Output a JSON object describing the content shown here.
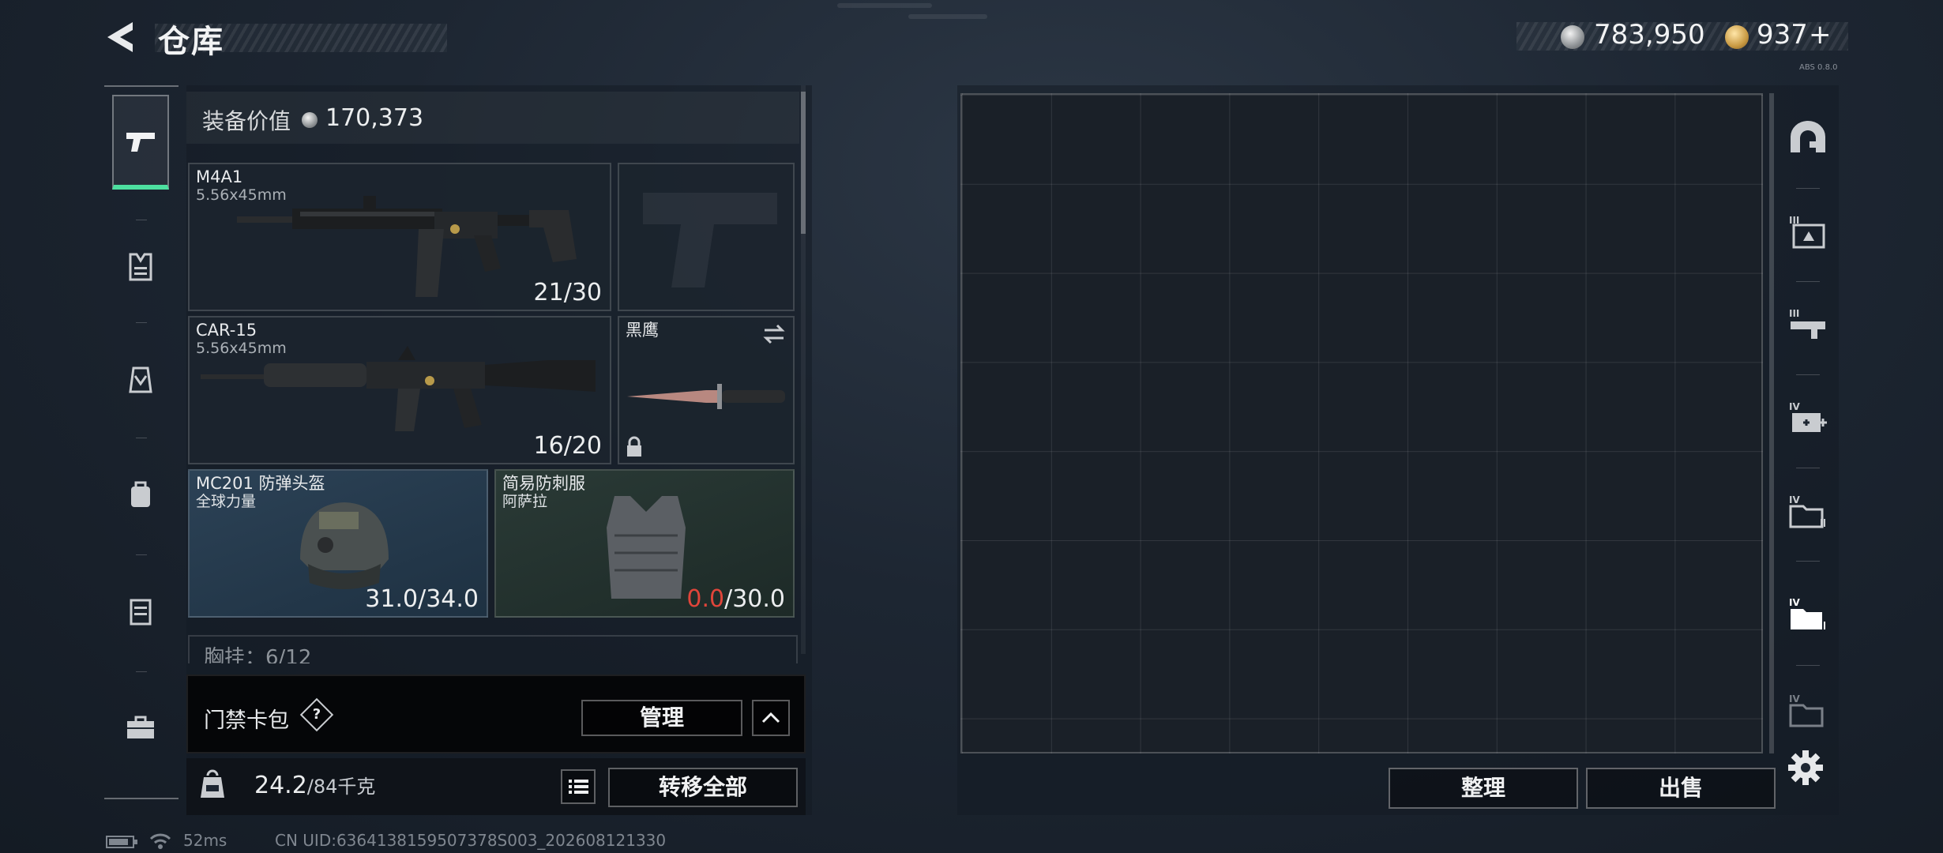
{
  "header": {
    "title": "仓库",
    "silver_currency": "783,950",
    "gold_currency": "937",
    "gold_plus": "+",
    "version": "ABS 0.8.0"
  },
  "equipment": {
    "value_label": "装备价值",
    "value": "170,373",
    "slots": [
      {
        "name": "M4A1",
        "caliber": "5.56x45mm",
        "ammo": "21/30"
      },
      {
        "name": "CAR-15",
        "caliber": "5.56x45mm",
        "ammo": "16/20"
      },
      {
        "name": "黑鹰"
      },
      {
        "name": "MC201 防弹头盔",
        "subtitle": "全球力量",
        "durability": "31.0/34.0"
      },
      {
        "name": "简易防刺服",
        "subtitle": "阿萨拉",
        "durability_current": "0.0",
        "durability_max": "/30.0"
      }
    ],
    "chest_rig": "胸挂：6/12"
  },
  "keycard": {
    "label": "门禁卡包",
    "help": "?",
    "manage": "管理"
  },
  "bottom": {
    "weight_current": "24.2",
    "weight_max": "/84千克",
    "transfer_all": "转移全部"
  },
  "storage": {
    "sort": "整理",
    "sell": "出售"
  },
  "status": {
    "ping": "52ms",
    "uid": "CN UID:6364138159507378S003_202608121330"
  },
  "colors": {
    "accent_green": "#4de0a0",
    "warning_red": "#e0453a"
  },
  "icons": {
    "left_rail": [
      "pistol-icon",
      "armor-vest-icon",
      "chest-rig-icon",
      "backpack-icon",
      "container-icon",
      "case-icon"
    ],
    "right_rail": [
      "arch-icon",
      "tier-III-case-icon",
      "tier-III-rifle-icon",
      "tier-IV-medkit-icon",
      "tier-IV-folder-icon",
      "tier-IV-folder-active-icon",
      "tier-IV-folder-dim-icon"
    ]
  }
}
